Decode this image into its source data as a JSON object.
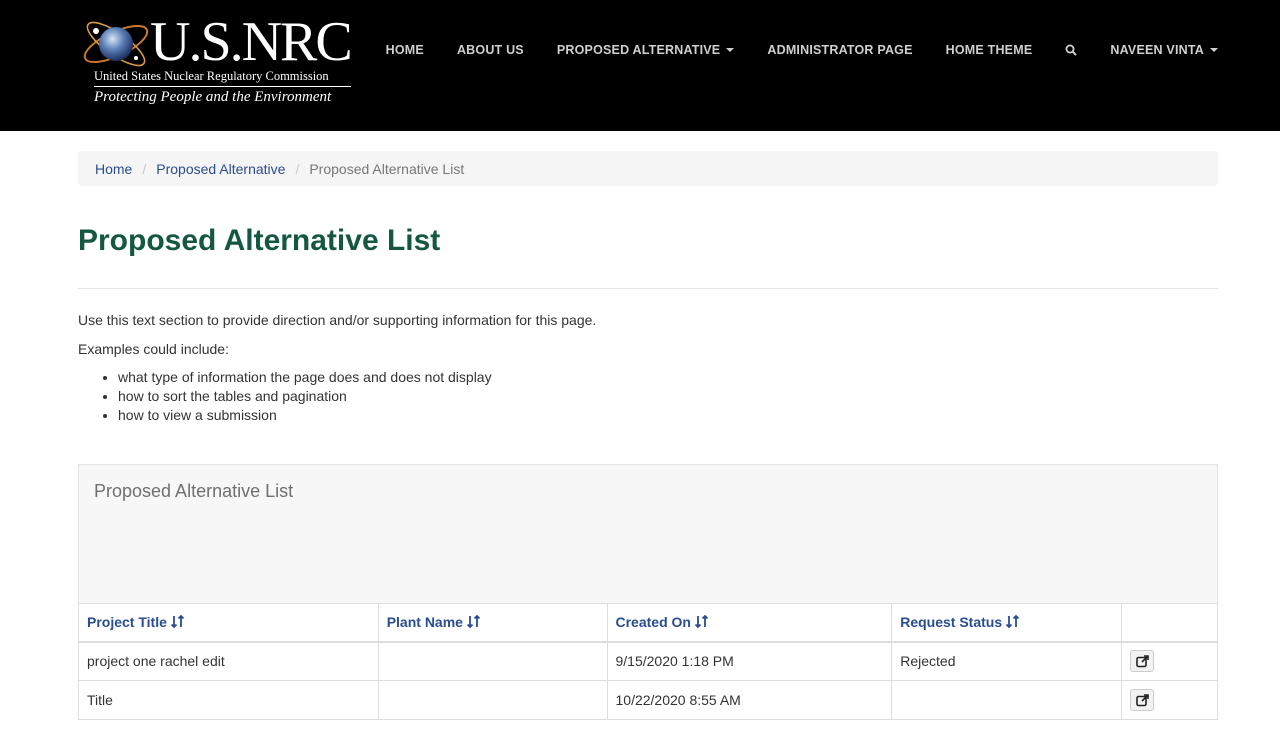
{
  "header": {
    "logo": {
      "main": "U.S.NRC",
      "sub": "United States Nuclear Regulatory Commission",
      "tagline": "Protecting People and the Environment"
    },
    "nav": [
      {
        "label": "HOME"
      },
      {
        "label": "ABOUT US"
      },
      {
        "label": "PROPOSED ALTERNATIVE",
        "dropdown": true
      },
      {
        "label": "ADMINISTRATOR PAGE"
      },
      {
        "label": "HOME THEME"
      },
      {
        "icon": "search-icon"
      },
      {
        "label": "NAVEEN VINTA",
        "dropdown": true
      }
    ]
  },
  "breadcrumb": {
    "items": [
      "Home",
      "Proposed Alternative"
    ],
    "active": "Proposed Alternative List"
  },
  "page": {
    "title": "Proposed Alternative List",
    "intro": "Use this text section to provide direction and/or supporting information for this page.",
    "examples_label": "Examples could include:",
    "examples": [
      "what type of information the page does and does not display",
      "how to sort the tables and pagination",
      "how to view a submission"
    ]
  },
  "panel": {
    "title": "Proposed Alternative List"
  },
  "table": {
    "columns": [
      "Project Title",
      "Plant Name",
      "Created On",
      "Request Status"
    ],
    "rows": [
      {
        "project_title": "project one rachel edit",
        "plant_name": "",
        "created_on": "9/15/2020 1:18 PM",
        "status": "Rejected"
      },
      {
        "project_title": "Title",
        "plant_name": "",
        "created_on": "10/22/2020 8:55 AM",
        "status": ""
      }
    ]
  },
  "colors": {
    "navbar": "#000000",
    "title_green": "#14593f",
    "link_blue": "#2a4d8f"
  }
}
